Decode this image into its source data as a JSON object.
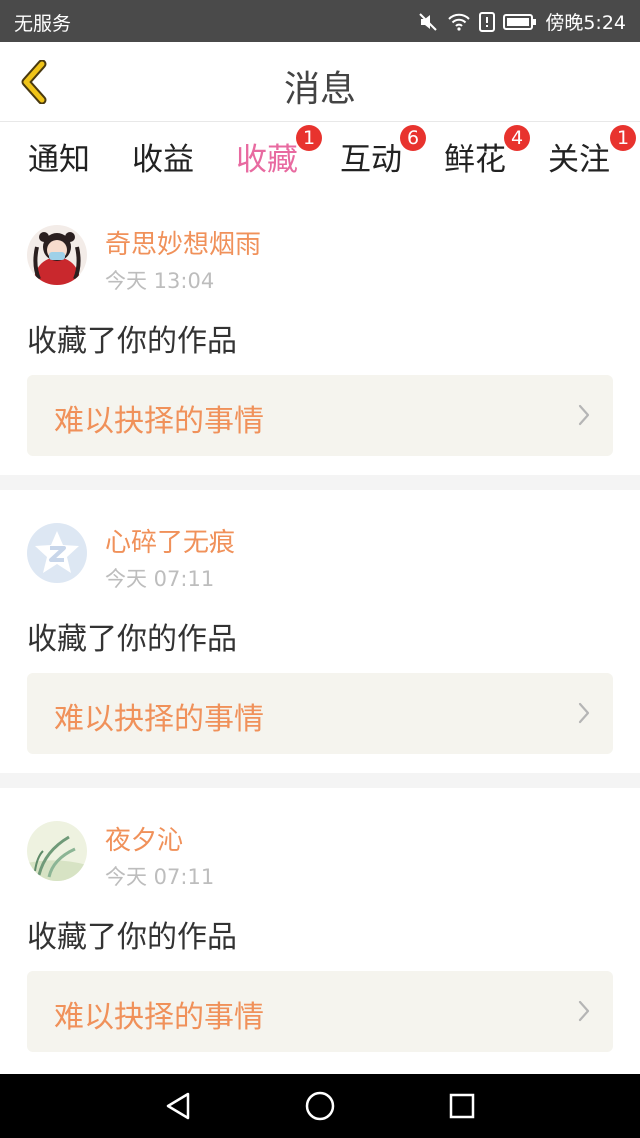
{
  "status_bar": {
    "carrier": "无服务",
    "time": "傍晚5:24"
  },
  "header": {
    "title": "消息"
  },
  "tabs": [
    {
      "label": "通知",
      "badge": ""
    },
    {
      "label": "收益",
      "badge": ""
    },
    {
      "label": "收藏",
      "badge": "1"
    },
    {
      "label": "互动",
      "badge": "6"
    },
    {
      "label": "鲜花",
      "badge": "4"
    },
    {
      "label": "关注",
      "badge": "1"
    }
  ],
  "active_tab": "收藏",
  "items": [
    {
      "username": "奇思妙想烟雨",
      "time": "今天 13:04",
      "action": "收藏了你的作品",
      "work": "难以抉择的事情"
    },
    {
      "username": "心碎了无痕",
      "time": "今天 07:11",
      "action": "收藏了你的作品",
      "work": "难以抉择的事情"
    },
    {
      "username": "夜夕沁",
      "time": "今天 07:11",
      "action": "收藏了你的作品",
      "work": "难以抉择的事情"
    }
  ],
  "colors": {
    "accent": "#e86aa0",
    "username": "#f0915a",
    "badge": "#e8332e",
    "back_arrow": "#f0c419"
  },
  "icons": [
    "mute-icon",
    "wifi-icon",
    "sim-alert-icon",
    "battery-icon",
    "back-arrow-icon",
    "chevron-right-icon",
    "nav-back-icon",
    "nav-home-icon",
    "nav-recents-icon"
  ]
}
